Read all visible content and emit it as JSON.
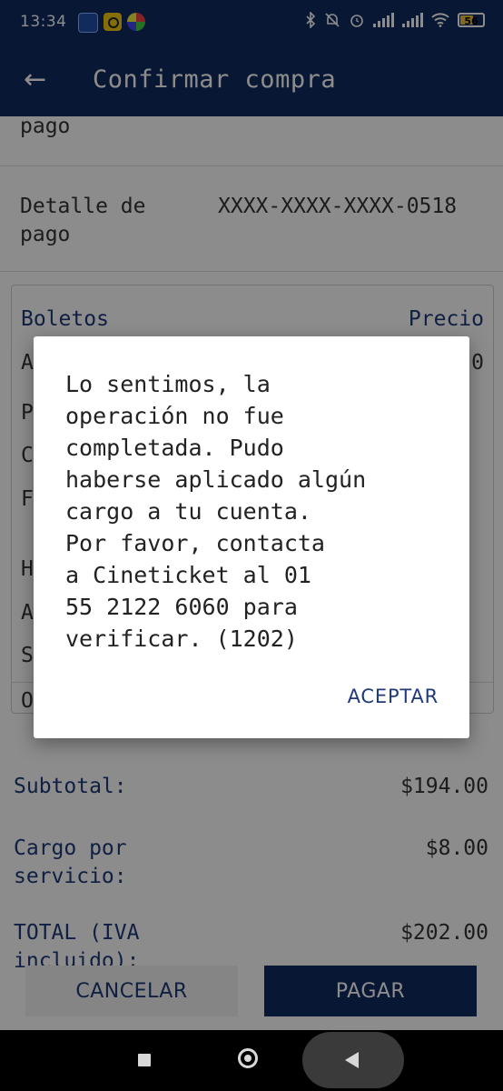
{
  "status_bar": {
    "time": "13:34",
    "notification_icons": [
      "bbva-icon",
      "yellow-app-icon",
      "multicolor-app-icon"
    ],
    "battery_level": "56"
  },
  "app_bar": {
    "back_glyph": "←",
    "title": "Confirmar compra"
  },
  "payment": {
    "method_label_tail": "pago",
    "detail_label": "Detalle de\npago",
    "detail_value": "XXXX-XXXX-XXXX-0518"
  },
  "tickets": {
    "header_left": "Boletos",
    "header_right": "Precio",
    "peek_letters": [
      "A",
      "P",
      "C",
      "F",
      "H",
      "A",
      "S",
      "O"
    ],
    "peek_right": "0"
  },
  "summary": {
    "subtotal_label": "Subtotal:",
    "subtotal_value": "$194.00",
    "service_label": "Cargo por\nservicio:",
    "service_value": "$8.00",
    "total_label": "TOTAL (IVA\nincluido):",
    "total_value": "$202.00"
  },
  "buttons": {
    "cancel": "CANCELAR",
    "pay": "PAGAR"
  },
  "dialog": {
    "message": "Lo sentimos, la\noperación no fue\ncompletada. Pudo\nhaberse aplicado algún\ncargo a tu cuenta.\nPor favor, contacta\na Cineticket al 01\n55 2122 6060 para\nverificar.  (1202)",
    "accept": "ACEPTAR"
  },
  "colors": {
    "brand_navy": "#0f2a5f",
    "accent_blue": "#1e3a78"
  }
}
